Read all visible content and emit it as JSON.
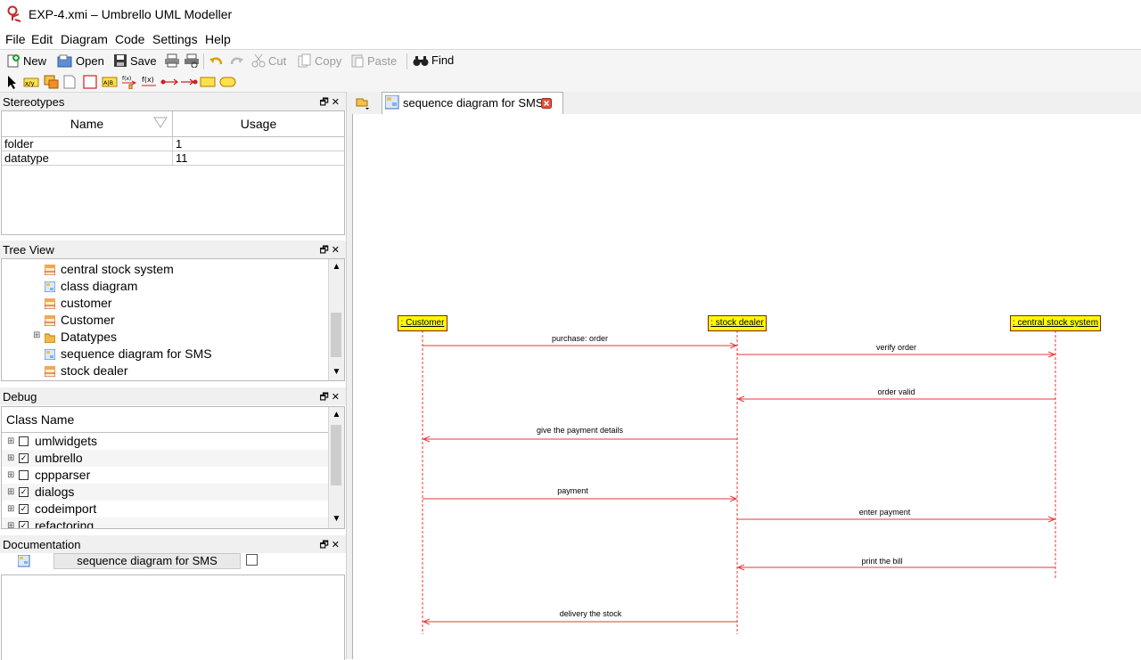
{
  "window": {
    "title": "EXP-4.xmi – Umbrello UML Modeller"
  },
  "menu": [
    "File",
    "Edit",
    "Diagram",
    "Code",
    "Settings",
    "Help"
  ],
  "toolbar": {
    "new": "New",
    "open": "Open",
    "save": "Save",
    "cut": "Cut",
    "copy": "Copy",
    "paste": "Paste",
    "find": "Find"
  },
  "stereotypes": {
    "title": "Stereotypes",
    "columns": [
      "Name",
      "Usage"
    ],
    "rows": [
      {
        "name": "folder",
        "usage": "1"
      },
      {
        "name": "datatype",
        "usage": "11"
      }
    ]
  },
  "tree": {
    "title": "Tree View",
    "items": [
      {
        "label": "central stock system",
        "icon": "class-icon"
      },
      {
        "label": "class diagram",
        "icon": "diagram-icon"
      },
      {
        "label": "customer",
        "icon": "class-icon"
      },
      {
        "label": "Customer",
        "icon": "class-icon"
      },
      {
        "label": "Datatypes",
        "icon": "folder-icon"
      },
      {
        "label": "sequence diagram for SMS",
        "icon": "diagram-icon"
      },
      {
        "label": "stock dealer",
        "icon": "class-icon"
      }
    ]
  },
  "debug": {
    "title": "Debug",
    "column": "Class Name",
    "rows": [
      {
        "label": "umlwidgets",
        "checked": false
      },
      {
        "label": "umbrello",
        "checked": true
      },
      {
        "label": "cppparser",
        "checked": false
      },
      {
        "label": "dialogs",
        "checked": true
      },
      {
        "label": "codeimport",
        "checked": true
      },
      {
        "label": "refactoring",
        "checked": true
      }
    ]
  },
  "documentation": {
    "title": "Documentation",
    "field": "sequence diagram for SMS"
  },
  "tab": {
    "label": "sequence diagram for SMS"
  },
  "diagram": {
    "objects": [
      ": Customer",
      ": stock dealer",
      ": central stock system"
    ],
    "messages": [
      "purchase: order",
      "verify order",
      "order valid",
      "give the payment details",
      "payment",
      "enter payment",
      "print the bill",
      "delivery the stock"
    ],
    "line_color": "#e53935",
    "object_fill": "#ffff00"
  }
}
